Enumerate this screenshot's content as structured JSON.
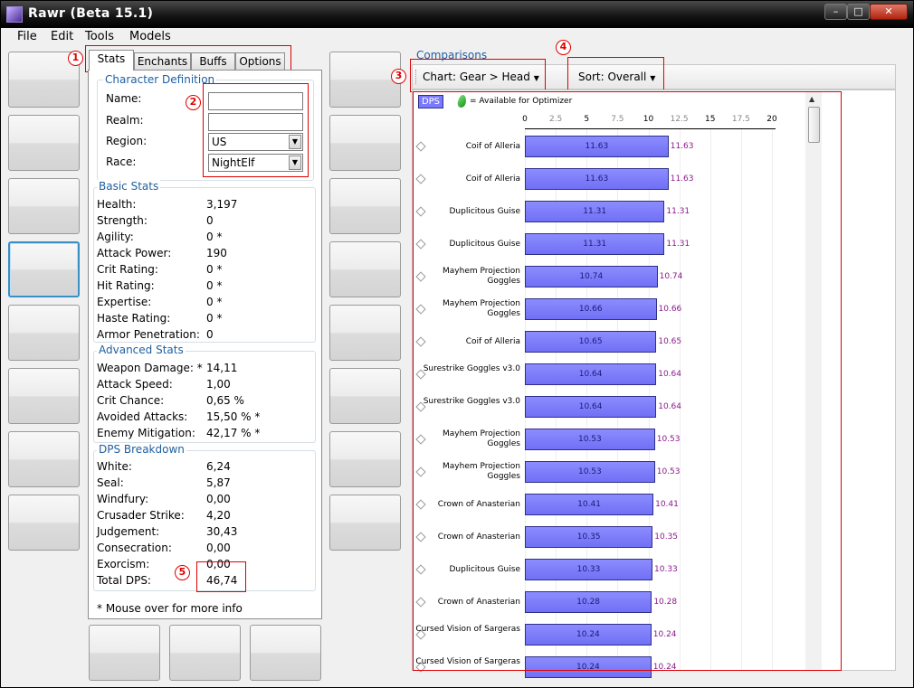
{
  "window": {
    "title": "Rawr (Beta 15.1)"
  },
  "menu": [
    "File",
    "Edit",
    "Tools",
    "Models"
  ],
  "tabs": [
    "Stats",
    "Enchants",
    "Buffs",
    "Options"
  ],
  "character": {
    "title": "Character Definition",
    "name_label": "Name:",
    "name_value": "",
    "realm_label": "Realm:",
    "realm_value": "",
    "region_label": "Region:",
    "region_value": "US",
    "race_label": "Race:",
    "race_value": "NightElf"
  },
  "basic": {
    "title": "Basic Stats",
    "rows": [
      {
        "label": "Health:",
        "value": "3,197"
      },
      {
        "label": "Strength:",
        "value": "0"
      },
      {
        "label": "Agility:",
        "value": "0 *"
      },
      {
        "label": "Attack Power:",
        "value": "190"
      },
      {
        "label": "Crit Rating:",
        "value": "0 *"
      },
      {
        "label": "Hit Rating:",
        "value": "0 *"
      },
      {
        "label": "Expertise:",
        "value": "0 *"
      },
      {
        "label": "Haste Rating:",
        "value": "0 *"
      },
      {
        "label": "Armor Penetration:",
        "value": "0"
      }
    ]
  },
  "advanced": {
    "title": "Advanced Stats",
    "rows": [
      {
        "label": "Weapon Damage: *",
        "value": "14,11"
      },
      {
        "label": "Attack Speed:",
        "value": "1,00"
      },
      {
        "label": "Crit Chance:",
        "value": "0,65 %"
      },
      {
        "label": "Avoided Attacks:",
        "value": "15,50 % *"
      },
      {
        "label": "Enemy Mitigation:",
        "value": "42,17 % *"
      }
    ]
  },
  "dps": {
    "title": "DPS Breakdown",
    "rows": [
      {
        "label": "White:",
        "value": "6,24"
      },
      {
        "label": "Seal:",
        "value": "5,87"
      },
      {
        "label": "Windfury:",
        "value": "0,00"
      },
      {
        "label": "Crusader Strike:",
        "value": "4,20"
      },
      {
        "label": "Judgement:",
        "value": "30,43"
      },
      {
        "label": "Consecration:",
        "value": "0,00"
      },
      {
        "label": "Exorcism:",
        "value": "0,00"
      },
      {
        "label": "Total DPS:",
        "value": "46,74"
      }
    ]
  },
  "footnote": "* Mouse over for more info",
  "comparisons": {
    "title": "Comparisons",
    "chart_label": "Chart:",
    "chart_value": "Gear > Head",
    "sort_label": "Sort:",
    "sort_value": "Overall",
    "legend_dps": "DPS",
    "legend_available": "= Available for Optimizer"
  },
  "badges": [
    "1",
    "2",
    "3",
    "4",
    "5"
  ],
  "colors": {
    "bar": "#7a7aff",
    "bar_label": "#8b1a8b",
    "highlight": "#e00000",
    "accent": "#1e5fa0"
  },
  "chart_data": {
    "type": "bar",
    "orientation": "horizontal",
    "xlim": [
      0,
      20
    ],
    "xticks": [
      "0",
      "2.5",
      "5",
      "7.5",
      "10",
      "12.5",
      "15",
      "17.5",
      "20"
    ],
    "series": [
      {
        "name": "DPS"
      }
    ],
    "items": [
      {
        "name": "Coif of Alleria",
        "value": 11.63
      },
      {
        "name": "Coif of Alleria",
        "value": 11.63
      },
      {
        "name": "Duplicitous Guise",
        "value": 11.31
      },
      {
        "name": "Duplicitous Guise",
        "value": 11.31
      },
      {
        "name": "Mayhem Projection Goggles",
        "value": 10.74
      },
      {
        "name": "Mayhem Projection Goggles",
        "value": 10.66
      },
      {
        "name": "Coif of Alleria",
        "value": 10.65
      },
      {
        "name": "Surestrike Goggles v3.0",
        "value": 10.64
      },
      {
        "name": "Surestrike Goggles v3.0",
        "value": 10.64
      },
      {
        "name": "Mayhem Projection Goggles",
        "value": 10.53
      },
      {
        "name": "Mayhem Projection Goggles",
        "value": 10.53
      },
      {
        "name": "Crown of Anasterian",
        "value": 10.41
      },
      {
        "name": "Crown of Anasterian",
        "value": 10.35
      },
      {
        "name": "Duplicitous Guise",
        "value": 10.33
      },
      {
        "name": "Crown of Anasterian",
        "value": 10.28
      },
      {
        "name": "Cursed Vision of Sargeras",
        "value": 10.24
      },
      {
        "name": "Cursed Vision of Sargeras",
        "value": 10.24
      }
    ]
  }
}
